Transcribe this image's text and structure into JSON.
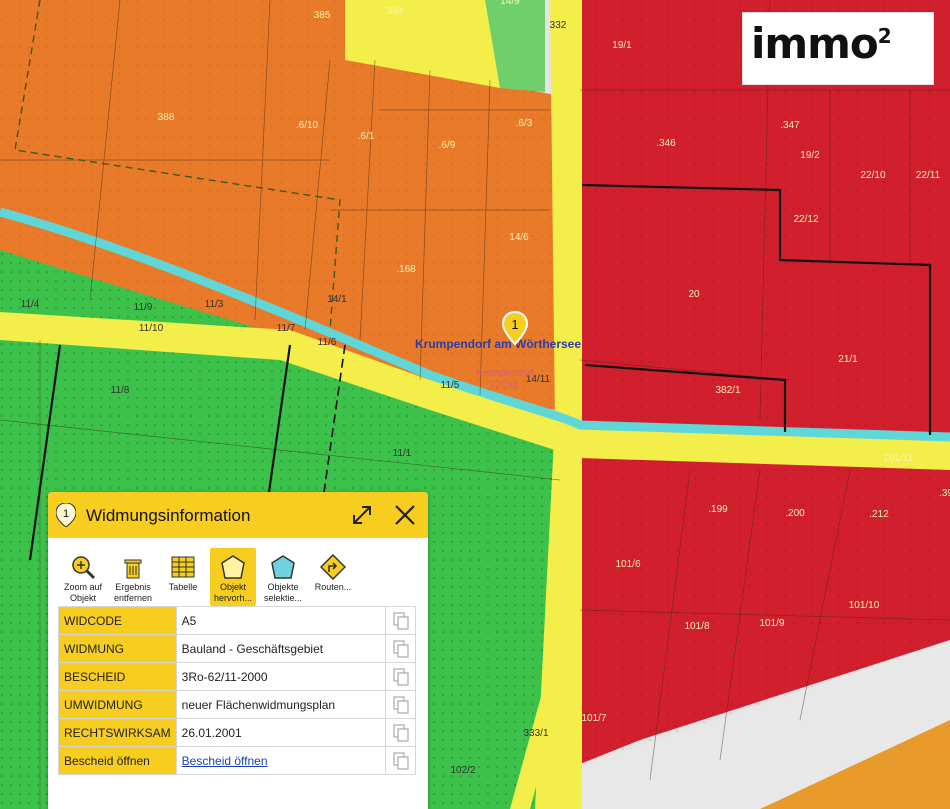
{
  "logo": {
    "text": "immo",
    "sup": "2"
  },
  "map": {
    "place_label": "Krumpendorf am Wörthersee",
    "place_code": "72133",
    "place_sub": "Krumpendorf",
    "pin_number": "1",
    "parcel_labels": [
      "385",
      "384",
      "14/9",
      "332",
      "19/1",
      "388",
      ".6/10",
      ".6/1",
      ".6/9",
      ".6/3",
      ".346",
      ".347",
      "19/2",
      "22/10",
      "22/11",
      "14/6",
      "22/12",
      ".168",
      "14/1",
      "20",
      "11/4",
      "11/9",
      "11/3",
      "11/10",
      "11/7",
      "11/6",
      "21/1",
      "382/1",
      "11/5",
      "14/11",
      "11/8",
      "11/1",
      "101/11",
      ".199",
      ".200",
      ".212",
      ".39",
      "101/6",
      "101/10",
      "101/8",
      "101/9",
      "101/7",
      "333/1",
      "102/2"
    ],
    "zone_colors": {
      "bauland_wohn": "#e87a2a",
      "geschaeft": "#d21f2e",
      "gruen": "#3cc24a",
      "verkehr": "#f3ee4a",
      "wasser": "#5fd6d8"
    }
  },
  "panel": {
    "badge": "1",
    "title": "Widmungsinformation",
    "tools": [
      {
        "label1": "Zoom auf",
        "label2": "Objekt",
        "icon": "zoom-icon"
      },
      {
        "label1": "Ergebnis",
        "label2": "entfernen",
        "icon": "trash-icon"
      },
      {
        "label1": "Tabelle",
        "label2": "",
        "icon": "table-icon"
      },
      {
        "label1": "Objekt",
        "label2": "hervorh...",
        "icon": "polygon-highlight-icon"
      },
      {
        "label1": "Objekte",
        "label2": "selektie...",
        "icon": "polygon-select-icon"
      },
      {
        "label1": "Routen...",
        "label2": "",
        "icon": "route-icon"
      }
    ],
    "rows": [
      {
        "key": "WIDCODE",
        "value": "A5"
      },
      {
        "key": "WIDMUNG",
        "value": "Bauland - Geschäftsgebiet"
      },
      {
        "key": "BESCHEID",
        "value": "3Ro-62/11-2000"
      },
      {
        "key": "UMWIDMUNG",
        "value": "neuer Flächenwidmungsplan"
      },
      {
        "key": "RECHTSWIRKSAM",
        "value": "26.01.2001"
      },
      {
        "key": "Bescheid öffnen",
        "value": "Bescheid öffnen"
      }
    ]
  }
}
